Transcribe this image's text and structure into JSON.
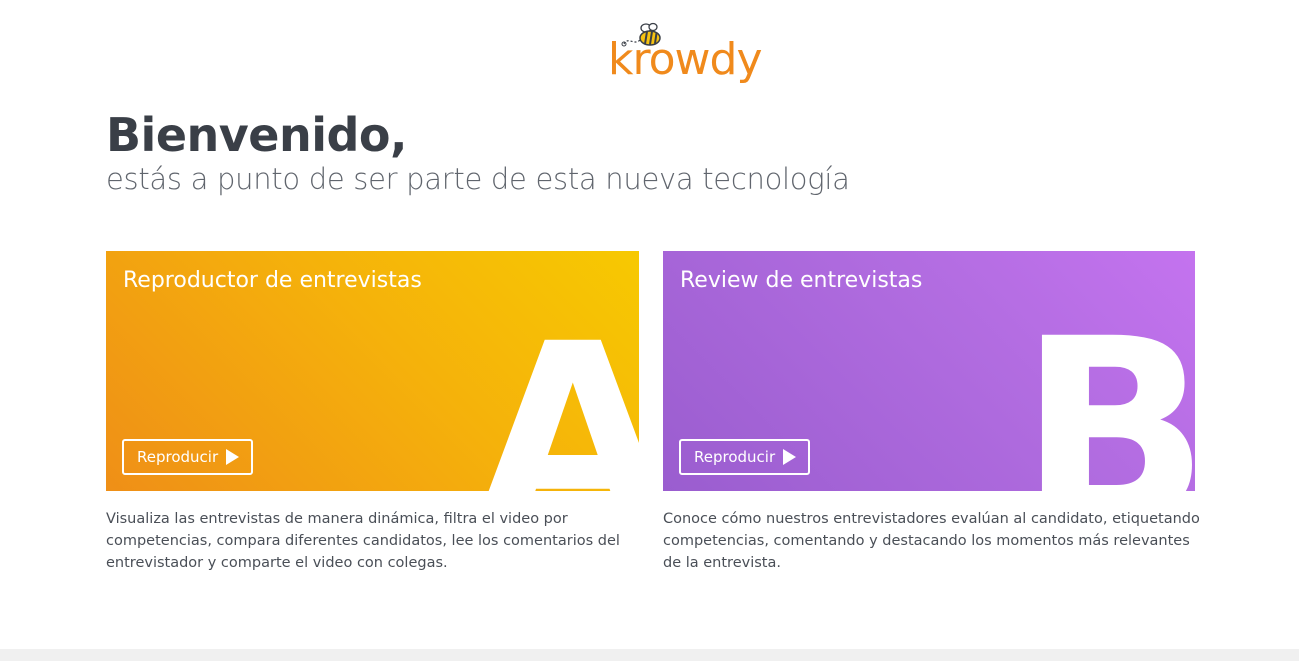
{
  "brand": {
    "name": "krowdy",
    "color": "#f08a1c",
    "mascot_icon": "bee-icon"
  },
  "hero": {
    "title": "Bienvenido,",
    "subtitle": "estás a punto de ser parte de esta nueva tecnología"
  },
  "cards": [
    {
      "title": "Reproductor de entrevistas",
      "letter": "A",
      "button_label": "Reproducir",
      "button_icon": "play-icon",
      "gradient": [
        "#ef8f17",
        "#f7c901"
      ],
      "description": "Visualiza las entrevistas de manera dinámica, filtra el video por competencias, compara diferentes candidatos, lee los comentarios del entrevistador y comparte el video con colegas."
    },
    {
      "title": "Review de entrevistas",
      "letter": "B",
      "button_label": "Reproducir",
      "button_icon": "play-icon",
      "gradient": [
        "#9a5dcf",
        "#c473ef"
      ],
      "description": "Conoce cómo nuestros entrevistadores evalúan al candidato, etiquetando competencias, comentando y destacando los momentos más relevantes de la entrevista."
    }
  ]
}
